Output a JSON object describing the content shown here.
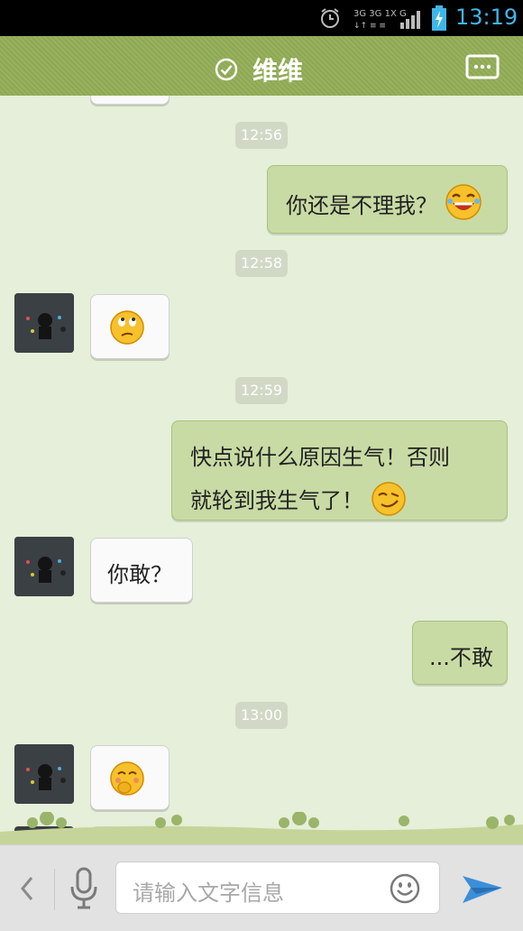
{
  "status_bar": {
    "time": "13:19",
    "network_label": "3G 3G 1X G",
    "icons": [
      "alarm-icon",
      "signal-icon",
      "battery-charging-icon"
    ]
  },
  "header": {
    "title": "维维",
    "status_icon": "online-check-icon",
    "menu_icon": "chat-menu-icon"
  },
  "chat": {
    "timestamps": [
      "12:56",
      "12:58",
      "12:59",
      "13:00"
    ],
    "messages": [
      {
        "side": "out",
        "text": "你还是不理我？",
        "emoji": "laughing-emoji"
      },
      {
        "side": "in",
        "text": "",
        "emoji": "thinking-emoji"
      },
      {
        "side": "out",
        "line1": "快点说什么原因生气！否则",
        "line2": "就轮到我生气了！",
        "emoji": "smug-emoji"
      },
      {
        "side": "in",
        "text": "你敢？"
      },
      {
        "side": "out",
        "text": "...不敢"
      },
      {
        "side": "in",
        "text": "",
        "emoji": "shy-giggle-emoji"
      }
    ]
  },
  "input_bar": {
    "placeholder": "请输入文字信息",
    "icons": [
      "back-chevron-icon",
      "microphone-icon",
      "smiley-icon",
      "send-icon"
    ]
  },
  "colors": {
    "header": "#92ad56",
    "chat_background": "#e6efd9",
    "outgoing_bubble": "#c9dba4",
    "incoming_bubble": "#fafafa",
    "time_accent": "#3fb6e8"
  }
}
